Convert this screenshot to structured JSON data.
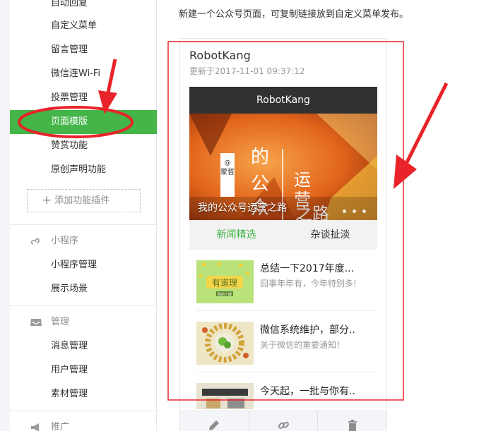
{
  "sidebar": {
    "items": [
      {
        "label": "自动回复"
      },
      {
        "label": "自定义菜单"
      },
      {
        "label": "留言管理"
      },
      {
        "label": "微信连Wi-Fi"
      },
      {
        "label": "投票管理"
      },
      {
        "label": "页面模版"
      },
      {
        "label": "赞赏功能"
      },
      {
        "label": "原创声明功能"
      }
    ],
    "add_plugin_label": "添加功能插件",
    "groups": [
      {
        "label": "小程序",
        "icon": "link-icon",
        "items": [
          {
            "label": "小程序管理"
          },
          {
            "label": "展示场景"
          }
        ]
      },
      {
        "label": "管理",
        "icon": "inbox-icon",
        "items": [
          {
            "label": "消息管理"
          },
          {
            "label": "用户管理"
          },
          {
            "label": "素材管理"
          }
        ]
      },
      {
        "label": "推广",
        "icon": "megaphone-icon"
      }
    ]
  },
  "main": {
    "note": "新建一个公众号页面，可复制链接放到自定义菜单发布。",
    "card": {
      "title": "RobotKang",
      "updated": "更新于2017-11-01 09:37:12",
      "phone_header": "RobotKang",
      "banner_caption": "我的公众号运营之路",
      "banner_art_text": {
        "at": "@",
        "name": "蒙哲",
        "big1": "的",
        "big2": "公",
        "big3": "众",
        "right1": "运",
        "right2": "营",
        "right3": "之",
        "right4": "路"
      },
      "tabs": [
        {
          "label": "新闻精选"
        },
        {
          "label": "杂谈扯淡"
        }
      ],
      "articles": [
        {
          "title": "总结一下2017年度...",
          "desc": "囧事年年有，今年特别多!",
          "thumb_text": "有道理",
          "thumb_sub": "我的了解"
        },
        {
          "title": "微信系统维护，部分..",
          "desc": "关于微信的重要通知！"
        },
        {
          "title": "今天起，一批与你有.."
        }
      ]
    },
    "toolbar": [
      {
        "icon": "pencil-icon"
      },
      {
        "icon": "link-icon"
      },
      {
        "icon": "trash-icon"
      }
    ]
  },
  "colors": {
    "accent": "#44b549",
    "annotation": "#e8232a",
    "header": "#323232"
  }
}
